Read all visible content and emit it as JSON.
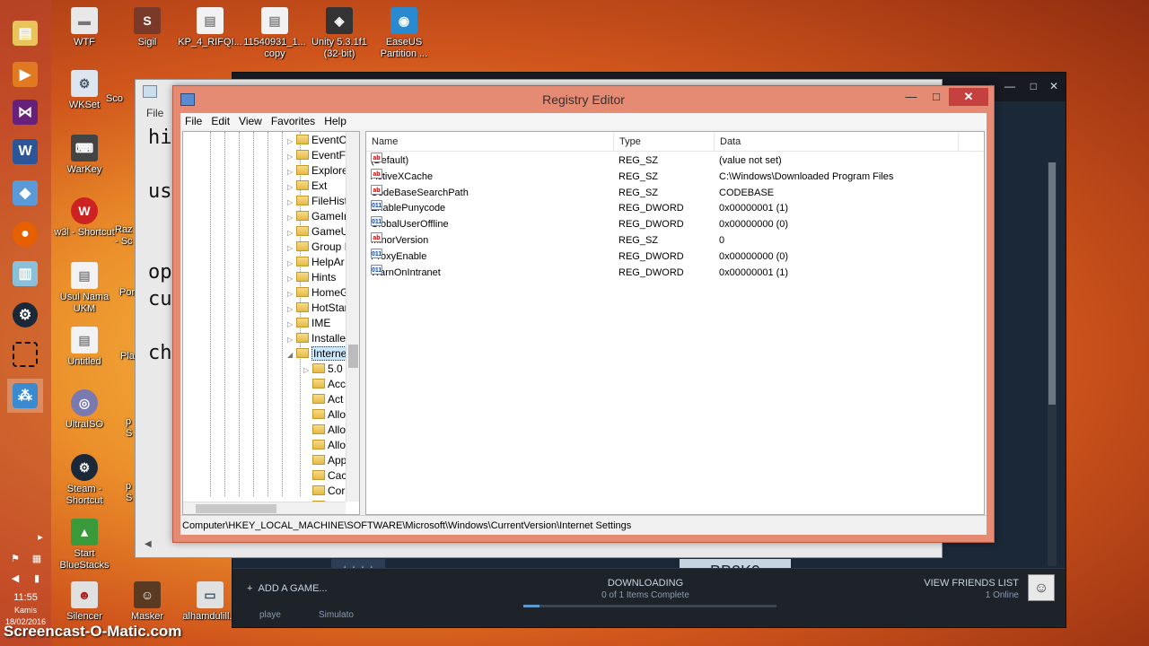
{
  "desktop_icons": [
    {
      "label": "WTF",
      "color": "#e8e8e8"
    },
    {
      "label": "Sigil",
      "color": "#7a3a2a"
    },
    {
      "label": "KP_4_RIFQI...",
      "color": "#f2f2f2"
    },
    {
      "label": "11540931_1... copy",
      "color": "#f2f2f2"
    },
    {
      "label": "Unity 5.3.1f1 (32-bit)",
      "color": "#333333"
    },
    {
      "label": "EaseUS Partition ...",
      "color": "#2a8ad0"
    },
    {
      "label": "WKSet",
      "color": "#dde6ee"
    },
    {
      "label": "WarKey",
      "color": "#444444"
    },
    {
      "label": "w3l - Shortcut",
      "color": "#cc2222"
    },
    {
      "label": "Usul Nama UKM",
      "color": "#f2f2f2"
    },
    {
      "label": "Untitled",
      "color": "#f2f2f2"
    },
    {
      "label": "UltraISO",
      "color": "#7a7ab0"
    },
    {
      "label": "Steam - Shortcut",
      "color": "#1b2838"
    },
    {
      "label": "Start BlueStacks",
      "color": "#3a9a3a"
    },
    {
      "label": "Silencer",
      "color": "#e0e0e0"
    },
    {
      "label": "Masker",
      "color": "#5a3a20"
    },
    {
      "label": "alhamdulill...",
      "color": "#e0e0e0"
    }
  ],
  "desktop_partial_labels": [
    "Sco",
    "Raz - Sc",
    "Por",
    "Pla",
    "p S",
    "p S"
  ],
  "clock": {
    "time": "11:55",
    "day": "Kamis",
    "date": "18/02/2016"
  },
  "watermark": "Screencast-O-Matic.com",
  "notepad": {
    "menu_file": "File",
    "text_lines": [
      "hi",
      "",
      "us",
      "",
      "",
      "op",
      "cu",
      "",
      "ch"
    ]
  },
  "steam": {
    "add_game": "ADD A GAME...",
    "downloading": "DOWNLOADING",
    "items_complete": "0 of 1 Items Complete",
    "view_friends": "VIEW FRIENDS LIST",
    "online": "1 Online",
    "partial_a": "★★★★",
    "partial_b": "BB2K9",
    "partial_c": "playe",
    "partial_d": "Simulato"
  },
  "regedit": {
    "title": "Registry Editor",
    "menu": [
      "File",
      "Edit",
      "View",
      "Favorites",
      "Help"
    ],
    "tree_items": [
      "EventC",
      "EventFo",
      "Explore",
      "Ext",
      "FileHist",
      "GameIn",
      "GameU",
      "Group I",
      "HelpAr",
      "Hints",
      "HomeG",
      "HotStar",
      "IME",
      "Installe",
      "Interne",
      "5.0",
      "Acc",
      "Act",
      "Allo",
      "Allo",
      "Allo",
      "App",
      "Cac",
      "Cor",
      "Htt"
    ],
    "columns": [
      "Name",
      "Type",
      "Data"
    ],
    "values": [
      {
        "name": "(Default)",
        "type": "REG_SZ",
        "data": "(value not set)",
        "icon": "string-value-icon"
      },
      {
        "name": "ActiveXCache",
        "type": "REG_SZ",
        "data": "C:\\Windows\\Downloaded Program Files",
        "icon": "string-value-icon"
      },
      {
        "name": "CodeBaseSearchPath",
        "type": "REG_SZ",
        "data": "CODEBASE",
        "icon": "string-value-icon"
      },
      {
        "name": "EnablePunycode",
        "type": "REG_DWORD",
        "data": "0x00000001 (1)",
        "icon": "binary-value-icon"
      },
      {
        "name": "GlobalUserOffline",
        "type": "REG_DWORD",
        "data": "0x00000000 (0)",
        "icon": "binary-value-icon"
      },
      {
        "name": "MinorVersion",
        "type": "REG_SZ",
        "data": "0",
        "icon": "string-value-icon"
      },
      {
        "name": "ProxyEnable",
        "type": "REG_DWORD",
        "data": "0x00000000 (0)",
        "icon": "binary-value-icon"
      },
      {
        "name": "WarnOnIntranet",
        "type": "REG_DWORD",
        "data": "0x00000001 (1)",
        "icon": "binary-value-icon"
      }
    ],
    "status_path": "Computer\\HKEY_LOCAL_MACHINE\\SOFTWARE\\Microsoft\\Windows\\CurrentVersion\\Internet Settings"
  },
  "colors": {
    "regedit_frame": "#e58a73",
    "close_button": "#c74040",
    "steam_bg": "#1b2838"
  }
}
